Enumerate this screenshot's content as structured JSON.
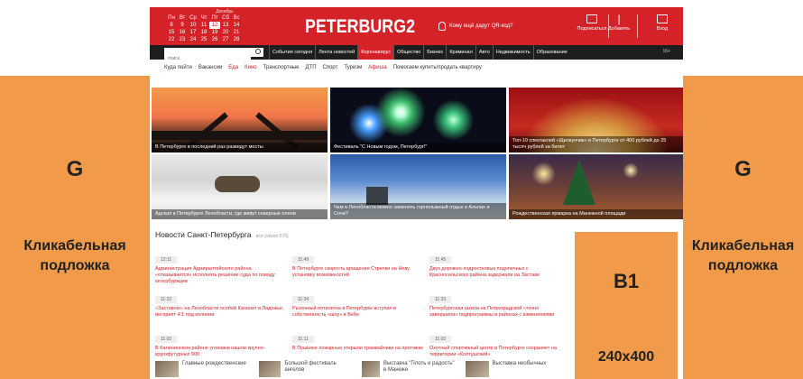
{
  "side": {
    "letter": "G",
    "caption_line1": "Кликабельная",
    "caption_line2": "подложка",
    "color": "#f09a4a"
  },
  "header": {
    "accent": "#d52128",
    "calendar": {
      "month": "Декабрь",
      "weekdays": [
        "Пн",
        "Вт",
        "Ср",
        "Чт",
        "Пт",
        "Сб",
        "Вс"
      ],
      "days": [
        "8",
        "9",
        "10",
        "11",
        "12",
        "13",
        "14",
        "15",
        "16",
        "17",
        "18",
        "19",
        "20",
        "21",
        "22",
        "23",
        "24",
        "25",
        "26",
        "27",
        "28"
      ],
      "today": "12"
    },
    "logo": "PETERBURG2",
    "qr_text": "Кому ещё дадут QR-код?",
    "actions": [
      {
        "label": "Подписаться",
        "icon": "mail-icon"
      },
      {
        "label": "Добавить",
        "icon": "add-icon"
      },
      {
        "label": "Вход",
        "icon": "login-icon"
      }
    ]
  },
  "navbar": {
    "search_placeholder": "поиск",
    "items": [
      {
        "label": "События сегодня",
        "active": false
      },
      {
        "label": "Лента новостей",
        "active": false
      },
      {
        "label": "Коронавирус",
        "active": true
      },
      {
        "label": "Общество",
        "active": false
      },
      {
        "label": "Бизнес",
        "active": false
      },
      {
        "label": "Криминал",
        "active": false
      },
      {
        "label": "Авто",
        "active": false
      },
      {
        "label": "Недвижимость",
        "active": false
      },
      {
        "label": "Образование",
        "active": false
      }
    ],
    "rss": "16+"
  },
  "subnav": {
    "items": [
      {
        "label": "Куда пойти",
        "red": false
      },
      {
        "label": "Вакансии",
        "red": false
      },
      {
        "label": "Еда",
        "red": true
      },
      {
        "label": "Кино",
        "red": true
      },
      {
        "label": "Транспортные",
        "red": false
      },
      {
        "label": "ДТП",
        "red": false
      },
      {
        "label": "Спорт",
        "red": false
      },
      {
        "label": "Туризм",
        "red": false
      },
      {
        "label": "Афиша",
        "red": true
      },
      {
        "label": "Помогаем купить/продать квартиру",
        "red": false
      }
    ]
  },
  "tiles": [
    {
      "caption": "В Петербурге в последний раз разведут мосты"
    },
    {
      "caption": "Фестиваль \"С Новым годом, Петербург!\""
    },
    {
      "caption": "Топ-10 спектаклей «Щелкунчик» в Петербурге от 400 рублей до 25 тысяч рублей за билет"
    },
    {
      "caption": "Адская в Петербурге Ленобласти, где живут северные олени"
    },
    {
      "caption": "Чем в Ленобласти можно заменить горнолыжный отдых в Альпах и Сочи?"
    },
    {
      "caption": "Рождественская ярмарка на Манежной площади"
    }
  ],
  "news": {
    "title": "Новости Санкт-Петербурга",
    "all_link": "все (около 570)",
    "columns": [
      [
        {
          "time": "12:11",
          "text": "Администрация Адмиралтейского района «отказывается» исполнять решение суда по поводу петербуржцев"
        },
        {
          "time": "11:22",
          "text": "«Заставлю» на Ленобласти особой Канонит в Ладожье, им прият 4:1 под колонии"
        },
        {
          "time": "11:02",
          "text": "В Калининском районе уголовки нашли крупно-кругофутурных 900"
        }
      ],
      [
        {
          "time": "11:49",
          "text": "В Петербурге скорость вращения Стрелки на Неву установку возможностей"
        },
        {
          "time": "11:34",
          "text": "Рыночный пятилетка в Петербурге вступил в собственность «шоу» в Вебе"
        },
        {
          "time": "11:11",
          "text": "В Пушкине пожарные открыли трамвайчики на протяжке"
        }
      ],
      [
        {
          "time": "11:45",
          "text": "Двух дорожно-подростковых подопечных с Красносельского района задержали на Заставе"
        },
        {
          "time": "11:33",
          "text": "Петербургская школа на Петроградской «точно завершила» подпрограммы в районах с изменениями"
        },
        {
          "time": "11:02",
          "text": "Охотный спортивный центр в Петербурге сохраняет на территории «Колтушский»"
        }
      ]
    ]
  },
  "bottom": [
    {
      "text": "Главные рождественские"
    },
    {
      "text": "Большой фестиваль ангелов"
    },
    {
      "text": "Выставка \"Плоть и радость\" в Манеже"
    },
    {
      "text": "Выставка необычных"
    }
  ],
  "banner": {
    "label": "B1",
    "size": "240x400"
  }
}
